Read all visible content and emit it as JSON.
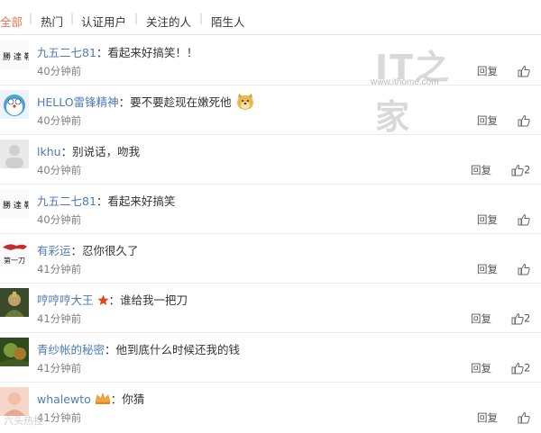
{
  "filters": [
    {
      "label": "全部",
      "active": true
    },
    {
      "label": "热门",
      "active": false
    },
    {
      "label": "认证用户",
      "active": false
    },
    {
      "label": "关注的人",
      "active": false
    },
    {
      "label": "陌生人",
      "active": false
    }
  ],
  "watermark": {
    "logo": "IT之家",
    "url": "www.ithome.com"
  },
  "reply_label": "回复",
  "comments": [
    {
      "user": "九五二七81",
      "text": "看起来好搞笑！！",
      "time": "40分钟前",
      "likes": ""
    },
    {
      "user": "HELLO雷锋精神",
      "text": "要不要趁现在嫩死他",
      "time": "40分钟前",
      "likes": ""
    },
    {
      "user": "lkhu",
      "text": "别说话，吻我",
      "time": "40分钟前",
      "likes": "2"
    },
    {
      "user": "九五二七81",
      "text": "看起来好搞笑",
      "time": "40分钟前",
      "likes": ""
    },
    {
      "user": "有彩运",
      "text": "忍你很久了",
      "time": "41分钟前",
      "likes": ""
    },
    {
      "user": "哼哼哼大王",
      "text": "谁给我一把刀",
      "time": "41分钟前",
      "likes": "2"
    },
    {
      "user": "青纱帐的秘密",
      "text": "他到底什么时候还我的钱",
      "time": "41分钟前",
      "likes": "2"
    },
    {
      "user": "whalewto",
      "text": "你猜",
      "time": "41分钟前",
      "likes": ""
    }
  ],
  "colors": {
    "accent": "#eb7350",
    "username": "#4d7ab5",
    "text": "#333333",
    "time": "#808080"
  },
  "footer_mark": "六头热捏"
}
